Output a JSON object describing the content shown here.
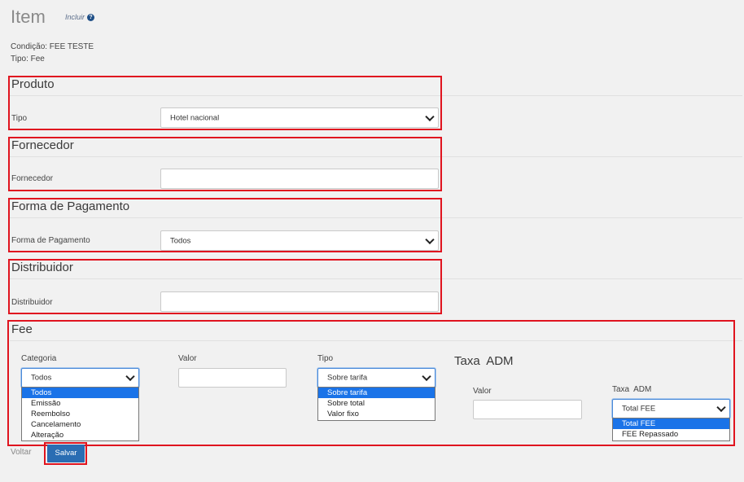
{
  "header": {
    "title": "Item",
    "incluir": "Incluir",
    "help_icon": "question-circle-icon"
  },
  "meta": {
    "condicao": "Condição: FEE TESTE",
    "tipo": "Tipo: Fee"
  },
  "produto": {
    "title": "Produto",
    "tipo_label": "Tipo",
    "tipo_value": "Hotel nacional"
  },
  "fornecedor": {
    "title": "Fornecedor",
    "label": "Fornecedor",
    "value": ""
  },
  "forma_pagamento": {
    "title": "Forma de Pagamento",
    "label": "Forma de Pagamento",
    "value": "Todos"
  },
  "distribuidor": {
    "title": "Distribuidor",
    "label": "Distribuidor",
    "value": ""
  },
  "fee": {
    "title": "Fee",
    "categoria": {
      "label": "Categoria",
      "value": "Todos",
      "options": [
        "Todos",
        "Emissão",
        "Reembolso",
        "Cancelamento",
        "Alteração"
      ]
    },
    "valor": {
      "label": "Valor",
      "value": ""
    },
    "tipo": {
      "label": "Tipo",
      "value": "Sobre tarifa",
      "options": [
        "Sobre tarifa",
        "Sobre total",
        "Valor fixo"
      ]
    },
    "taxa_adm": {
      "title": "Taxa  ADM",
      "valor_label": "Valor",
      "valor_value": "",
      "select_label": "Taxa  ADM",
      "select_value": "Total FEE",
      "options": [
        "Total FEE",
        "FEE Repassado"
      ]
    }
  },
  "actions": {
    "voltar": "Voltar",
    "salvar": "Salvar"
  },
  "colors": {
    "highlight_border": "#e0141f",
    "primary_button": "#2a6db3",
    "option_selected": "#1a73e8"
  }
}
